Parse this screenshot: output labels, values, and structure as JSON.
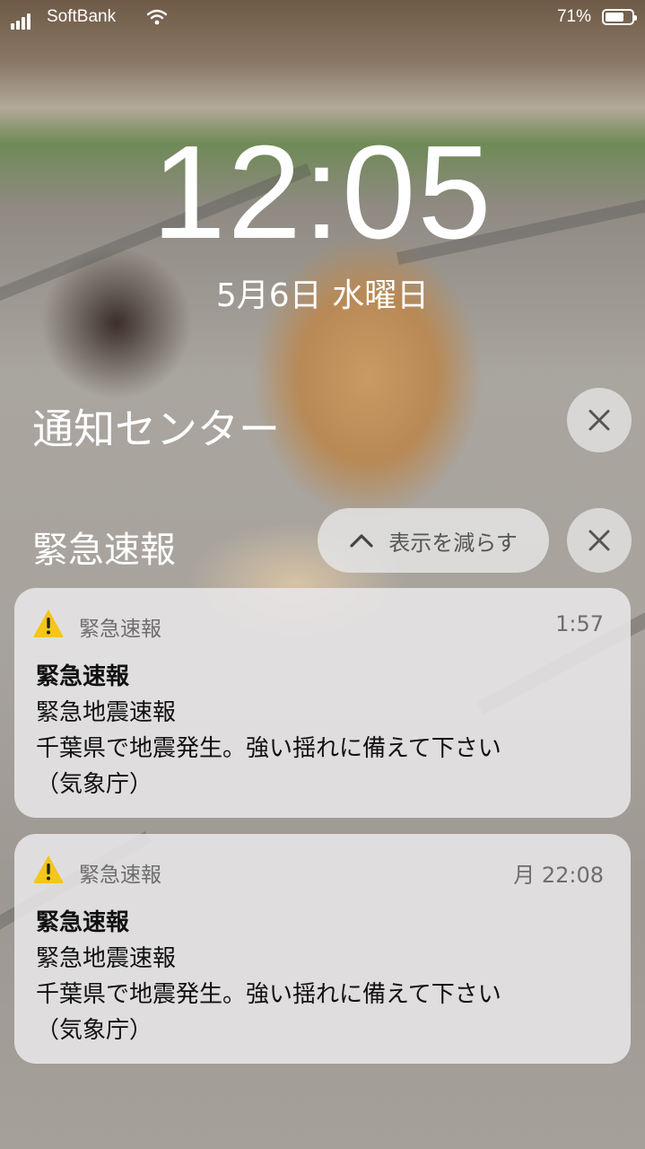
{
  "status_bar": {
    "carrier": "SoftBank",
    "battery_percent": "71%",
    "battery_level": 0.71,
    "signal_icon": "cellular-signal-icon",
    "wifi_icon": "wifi-icon"
  },
  "lock_screen": {
    "time": "12:05",
    "date": "5月6日 水曜日"
  },
  "notification_center": {
    "title": "通知センター",
    "close_icon": "close-icon"
  },
  "group": {
    "title": "緊急速報",
    "show_less_label": "表示を減らす",
    "chevron_icon": "chevron-up-icon",
    "close_icon": "close-icon"
  },
  "notifications": [
    {
      "app_icon": "warning-icon",
      "app_name": "緊急速報",
      "time": "1:57",
      "title": "緊急速報",
      "line1": "緊急地震速報",
      "line2": "千葉県で地震発生。強い揺れに備えて下さい",
      "line3": "（気象庁）"
    },
    {
      "app_icon": "warning-icon",
      "app_name": "緊急速報",
      "time": "月 22:08",
      "title": "緊急速報",
      "line1": "緊急地震速報",
      "line2": "千葉県で地震発生。強い揺れに備えて下さい",
      "line3": "（気象庁）"
    }
  ],
  "colors": {
    "warning_yellow": "#F5C518",
    "card_background": "#E8E6E8"
  }
}
